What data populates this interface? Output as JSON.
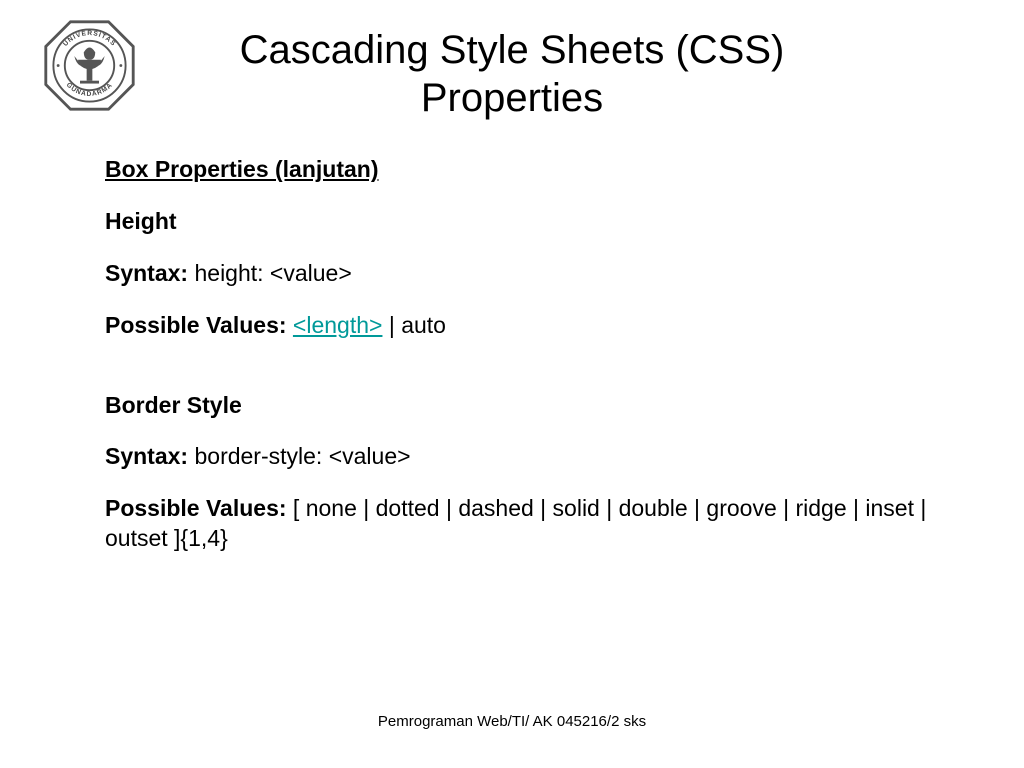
{
  "logo": {
    "top_text": "UNIVERSITAS",
    "bottom_text": "GUNADARMA"
  },
  "title_line1": "Cascading Style Sheets (CSS)",
  "title_line2": "Properties",
  "section_heading": "Box Properties (lanjutan)",
  "prop1": {
    "name": "Height",
    "syntax_label": "Syntax:",
    "syntax_value": " height: <value>",
    "pv_label": "Possible Values: ",
    "pv_link": "<length>",
    "pv_rest": " | auto"
  },
  "prop2": {
    "name": "Border Style",
    "syntax_label": "Syntax:",
    "syntax_value": " border-style: <value>",
    "pv_label": "Possible Values:",
    "pv_value": " [ none | dotted | dashed | solid | double | groove | ridge | inset | outset ]{1,4}"
  },
  "footer": "Pemrograman Web/TI/ AK 045216/2 sks"
}
